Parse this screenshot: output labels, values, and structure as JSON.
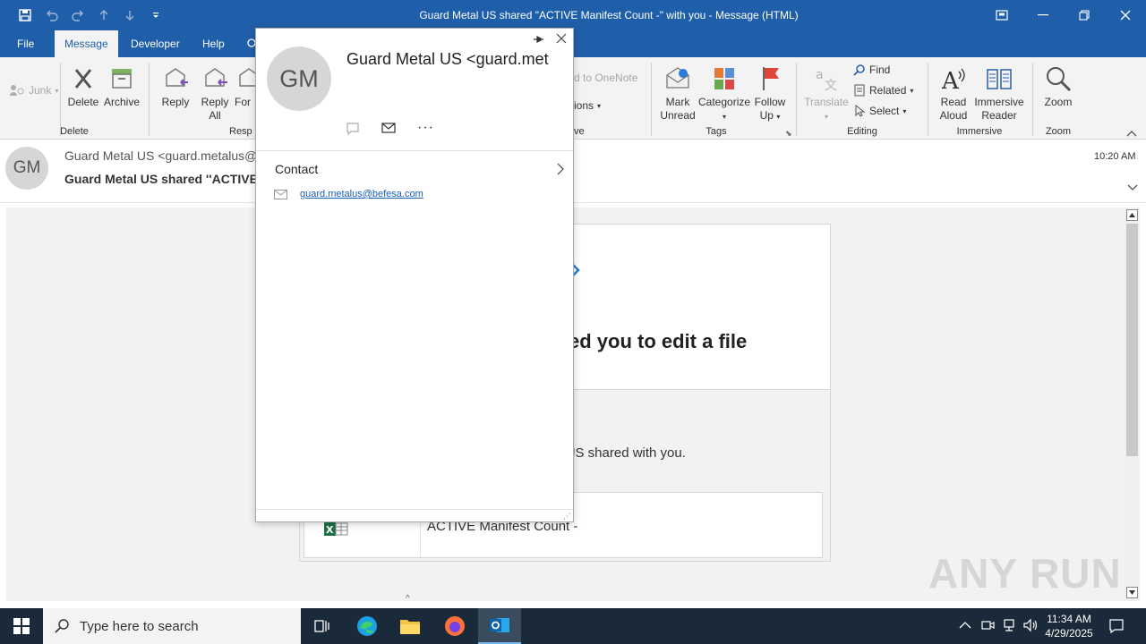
{
  "window": {
    "title": "Guard Metal US shared \"ACTIVE Manifest Count -\" with you  -  Message (HTML)"
  },
  "tabs": [
    {
      "label": "File"
    },
    {
      "label": "Message"
    },
    {
      "label": "Developer"
    },
    {
      "label": "Help"
    }
  ],
  "ribbon": {
    "junk": "Junk",
    "delete": "Delete",
    "archive": "Archive",
    "delete_group": "Delete",
    "reply": "Reply",
    "reply_all_1": "Reply",
    "reply_all_2": "All",
    "forward_partial": "For",
    "respond_group_partial": "Resp",
    "onenote_partial": "d to OneNote",
    "options_partial": "ions",
    "move_group_partial": "ve",
    "mark_unread_1": "Mark",
    "mark_unread_2": "Unread",
    "categorize": "Categorize",
    "follow_up_1": "Follow",
    "follow_up_2": "Up",
    "tags_group": "Tags",
    "translate": "Translate",
    "find": "Find",
    "related": "Related",
    "select": "Select",
    "editing_group": "Editing",
    "read_aloud_1": "Read",
    "read_aloud_2": "Aloud",
    "immersive_1": "Immersive",
    "immersive_2": "Reader",
    "immersive_group": "Immersive",
    "zoom": "Zoom",
    "zoom_group": "Zoom"
  },
  "header": {
    "avatar_initials": "GM",
    "from_partial": "Guard Metal US <guard.metalus@",
    "subject_partial": "Guard Metal US shared ''ACTIVE",
    "time": "10:20 AM"
  },
  "body": {
    "heading_partial": "ed you to edit a file",
    "shared_text_partial": "JS shared with you.",
    "file_name": "ACTIVE Manifest Count -"
  },
  "card": {
    "avatar_initials": "GM",
    "name_partial": "Guard Metal US <guard.met",
    "section_title": "Contact",
    "email": "guard.metalus@befesa.com"
  },
  "taskbar": {
    "search_placeholder": "Type here to search",
    "time": "11:34 AM",
    "date": "4/29/2025"
  },
  "watermark": "ANY RUN",
  "colors": {
    "accent": "#1f5fa9",
    "taskbar": "#1b2a3a",
    "link": "#1a5fb4"
  }
}
